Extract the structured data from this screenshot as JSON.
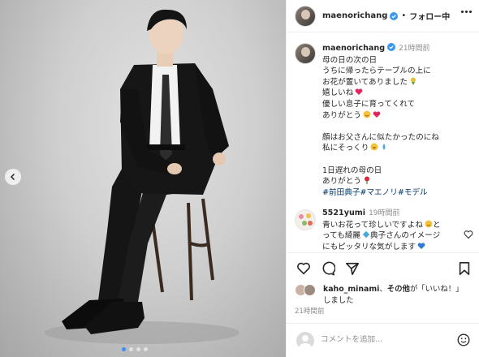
{
  "post": {
    "photo_alt": "",
    "dots_total": 4,
    "dots_active": 1
  },
  "header": {
    "username": "maenorichang",
    "separator": "•",
    "follow_label": "フォロー中"
  },
  "caption": {
    "username": "maenorichang",
    "time": "21時間前",
    "lines": [
      "母の日の次の日",
      "うちに帰ったらテーブルの上に",
      "お花が置いてありました",
      "嬉しいね",
      "優しい息子に育ってくれて",
      "ありがとう",
      "",
      "顔はお父さんに似たかったのにね",
      "私にそっくり",
      "",
      "1日遅れの母の日",
      "ありがとう"
    ],
    "tags": "#前田典子#マエノリ#モデル"
  },
  "comment": {
    "username": "5521yumi",
    "time": "19時間前",
    "lines": [
      "青いお花って珍しいですよね",
      "とっても綺麗",
      "典子さんのイメージにもピッタリな気がします"
    ],
    "line_a": "青いお花って珍しいですよね",
    "line_b": "と",
    "line_c": "っても綺麗",
    "line_d": "典子さんのイメージ",
    "line_e": "にもピッタリな気がします"
  },
  "likes": {
    "user": "kaho_minami",
    "middle": "、",
    "others": "その他",
    "suffix": "が「いいね！」",
    "line2": "しました"
  },
  "post_time": "21時間前",
  "composer": {
    "placeholder": "コメントを追加..."
  },
  "colors": {
    "verified": "#3897f0",
    "link": "#00376b",
    "muted": "#8e8e8e",
    "active_dot": "#3a8ef6"
  },
  "icons": [
    "heart-icon",
    "comment-icon",
    "share-icon",
    "bookmark-icon",
    "emoji-icon",
    "more-icon",
    "chevron-left-icon"
  ]
}
